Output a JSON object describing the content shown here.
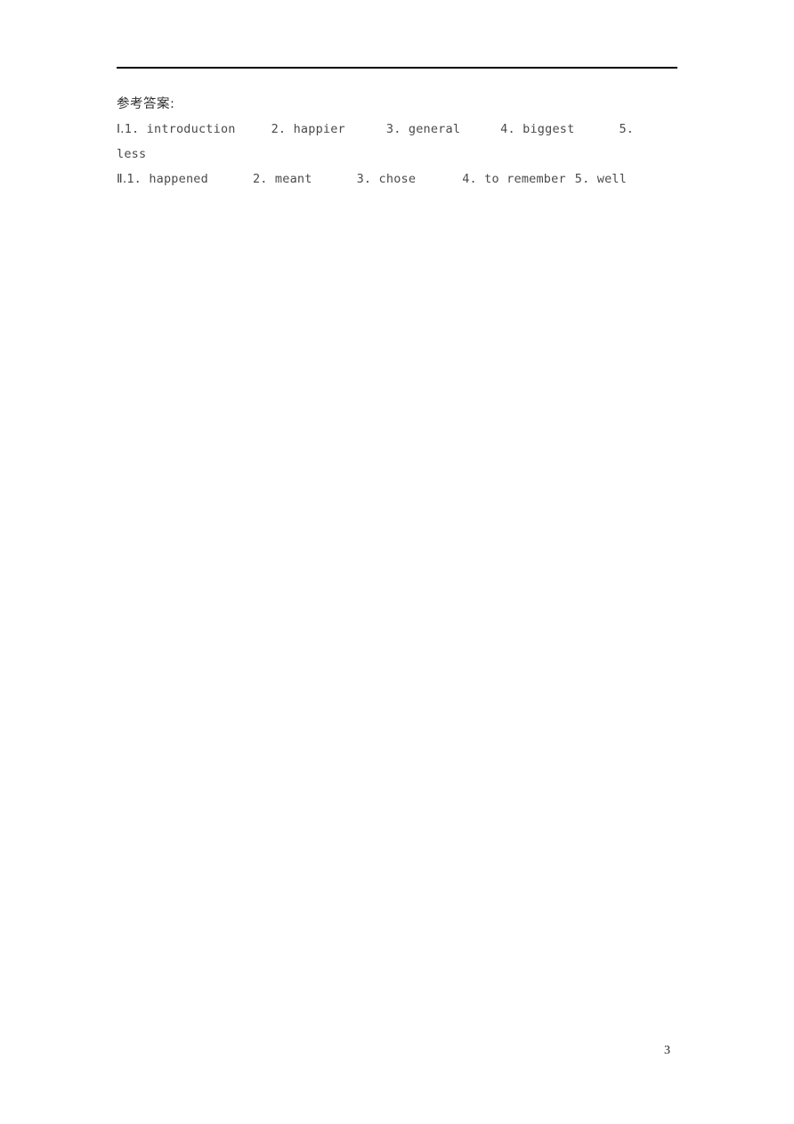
{
  "document": {
    "heading": "参考答案:",
    "page_number": "3",
    "rule": {
      "color": "#000000"
    },
    "answer_sections": [
      {
        "label": "Ⅰ.",
        "items": [
          "1. introduction",
          "2. happier",
          "3. general",
          "4. biggest",
          "5."
        ],
        "continuation": "less"
      },
      {
        "label": "Ⅱ.",
        "items": [
          "1. happened",
          "2. meant",
          "3. chose",
          "4. to remember",
          "5. well"
        ],
        "continuation": ""
      }
    ]
  }
}
